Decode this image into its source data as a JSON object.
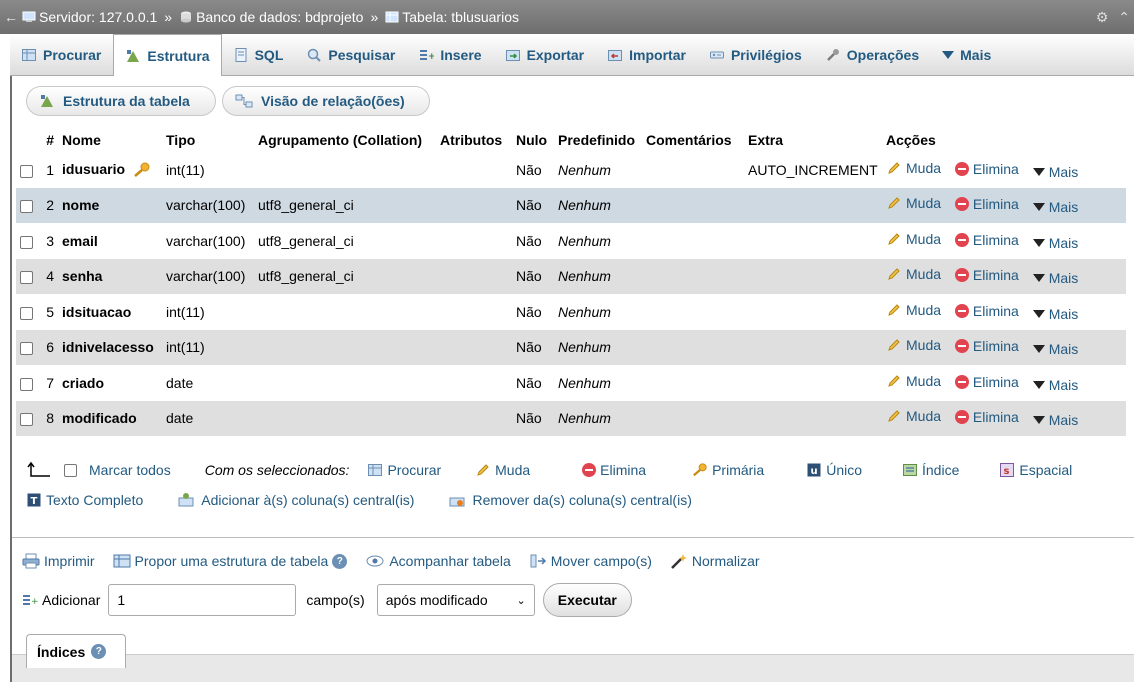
{
  "breadcrumb": {
    "back": "←",
    "server": "Servidor: 127.0.0.1",
    "database": "Banco de dados: bdprojeto",
    "table": "Tabela: tblusuarios",
    "separator": "»"
  },
  "tabs": [
    {
      "label": "Procurar",
      "icon": "browse-icon"
    },
    {
      "label": "Estrutura",
      "icon": "structure-icon",
      "active": true
    },
    {
      "label": "SQL",
      "icon": "sql-icon"
    },
    {
      "label": "Pesquisar",
      "icon": "search-icon"
    },
    {
      "label": "Insere",
      "icon": "insert-icon"
    },
    {
      "label": "Exportar",
      "icon": "export-icon"
    },
    {
      "label": "Importar",
      "icon": "import-icon"
    },
    {
      "label": "Privilégios",
      "icon": "privileges-icon"
    },
    {
      "label": "Operações",
      "icon": "wrench-icon"
    },
    {
      "label": "Mais",
      "icon": "triangle-down-icon"
    }
  ],
  "subtabs": {
    "structure": "Estrutura da tabela",
    "relations": "Visão de relação(ões)"
  },
  "columns": [
    "#",
    "Nome",
    "Tipo",
    "Agrupamento (Collation)",
    "Atributos",
    "Nulo",
    "Predefinido",
    "Comentários",
    "Extra",
    "Acções"
  ],
  "rows": [
    {
      "num": "1",
      "name": "idusuario",
      "type": "int(11)",
      "collation": "",
      "null": "Não",
      "default": "Nenhum",
      "extra": "AUTO_INCREMENT",
      "primary": true
    },
    {
      "num": "2",
      "name": "nome",
      "type": "varchar(100)",
      "collation": "utf8_general_ci",
      "null": "Não",
      "default": "Nenhum",
      "extra": ""
    },
    {
      "num": "3",
      "name": "email",
      "type": "varchar(100)",
      "collation": "utf8_general_ci",
      "null": "Não",
      "default": "Nenhum",
      "extra": ""
    },
    {
      "num": "4",
      "name": "senha",
      "type": "varchar(100)",
      "collation": "utf8_general_ci",
      "null": "Não",
      "default": "Nenhum",
      "extra": ""
    },
    {
      "num": "5",
      "name": "idsituacao",
      "type": "int(11)",
      "collation": "",
      "null": "Não",
      "default": "Nenhum",
      "extra": ""
    },
    {
      "num": "6",
      "name": "idnivelacesso",
      "type": "int(11)",
      "collation": "",
      "null": "Não",
      "default": "Nenhum",
      "extra": ""
    },
    {
      "num": "7",
      "name": "criado",
      "type": "date",
      "collation": "",
      "null": "Não",
      "default": "Nenhum",
      "extra": ""
    },
    {
      "num": "8",
      "name": "modificado",
      "type": "date",
      "collation": "",
      "null": "Não",
      "default": "Nenhum",
      "extra": ""
    }
  ],
  "row_actions": {
    "change": "Muda",
    "drop": "Elimina",
    "more": "Mais"
  },
  "bulk": {
    "check_all": "Marcar todos",
    "with_selected": "Com os seleccionados:",
    "browse": "Procurar",
    "change": "Muda",
    "drop": "Elimina",
    "primary": "Primária",
    "unique": "Único",
    "index": "Índice",
    "spatial": "Espacial",
    "fulltext": "Texto Completo",
    "add_central": "Adicionar à(s) coluna(s) central(is)",
    "remove_central": "Remover da(s) coluna(s) central(is)"
  },
  "footer": {
    "print": "Imprimir",
    "propose": "Propor uma estrutura de tabela",
    "track": "Acompanhar tabela",
    "move": "Mover campo(s)",
    "normalize": "Normalizar"
  },
  "add": {
    "label": "Adicionar",
    "value": "1",
    "fields": "campo(s)",
    "position": "após modificado",
    "execute": "Executar"
  },
  "indices": {
    "label": "Índices"
  },
  "colors": {
    "link": "#235a81",
    "row_alt": "#dfdfdf",
    "row_hover": "#cfd9e2"
  }
}
